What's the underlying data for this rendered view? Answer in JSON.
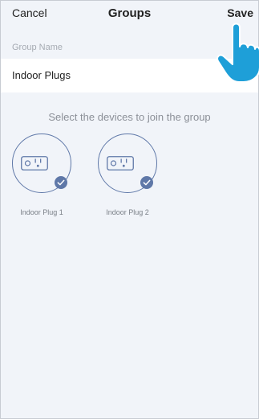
{
  "navbar": {
    "cancel_label": "Cancel",
    "title": "Groups",
    "save_label": "Save"
  },
  "group_name": {
    "label": "Group Name",
    "value": "Indoor Plugs"
  },
  "hint": "Select the devices to join the group",
  "devices": [
    {
      "label": "Indoor Plug 1",
      "selected": true
    },
    {
      "label": "Indoor Plug 2",
      "selected": true
    }
  ],
  "colors": {
    "accent": "#5f78a8",
    "pointer": "#1e9fd8",
    "background": "#f1f4f9"
  },
  "icons": {
    "device": "smart-plug-icon",
    "selected": "checkmark-icon",
    "pointer": "pointing-hand-icon"
  }
}
